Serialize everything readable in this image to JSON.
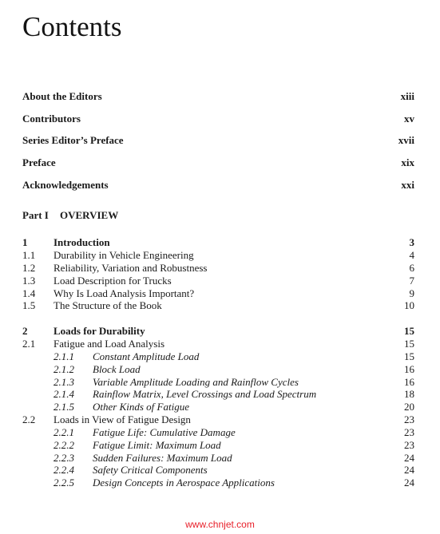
{
  "page": {
    "title": "Contents"
  },
  "front_matter": [
    {
      "label": "About the Editors",
      "page": "xiii"
    },
    {
      "label": "Contributors",
      "page": "xv"
    },
    {
      "label": "Series Editor’s Preface",
      "page": "xvii"
    },
    {
      "label": "Preface",
      "page": "xix"
    },
    {
      "label": "Acknowledgements",
      "page": "xxi"
    }
  ],
  "part": {
    "number": "Part I",
    "title": "OVERVIEW"
  },
  "chapters": [
    {
      "number": "1",
      "title": "Introduction",
      "page": "3",
      "sections": [
        {
          "number": "1.1",
          "title": "Durability in Vehicle Engineering",
          "page": "4"
        },
        {
          "number": "1.2",
          "title": "Reliability, Variation and Robustness",
          "page": "6"
        },
        {
          "number": "1.3",
          "title": "Load Description for Trucks",
          "page": "7"
        },
        {
          "number": "1.4",
          "title": "Why Is Load Analysis Important?",
          "page": "9"
        },
        {
          "number": "1.5",
          "title": "The Structure of the Book",
          "page": "10"
        }
      ]
    },
    {
      "number": "2",
      "title": "Loads for Durability",
      "page": "15",
      "sections": [
        {
          "number": "2.1",
          "title": "Fatigue and Load Analysis",
          "page": "15",
          "subsections": [
            {
              "number": "2.1.1",
              "title": "Constant Amplitude Load",
              "page": "15"
            },
            {
              "number": "2.1.2",
              "title": "Block Load",
              "page": "16"
            },
            {
              "number": "2.1.3",
              "title": "Variable Amplitude Loading and Rainflow Cycles",
              "page": "16"
            },
            {
              "number": "2.1.4",
              "title": "Rainflow Matrix, Level Crossings and Load Spectrum",
              "page": "18"
            },
            {
              "number": "2.1.5",
              "title": "Other Kinds of Fatigue",
              "page": "20"
            }
          ]
        },
        {
          "number": "2.2",
          "title": "Loads in View of Fatigue Design",
          "page": "23",
          "subsections": [
            {
              "number": "2.2.1",
              "title": "Fatigue Life: Cumulative Damage",
              "page": "23"
            },
            {
              "number": "2.2.2",
              "title": "Fatigue Limit: Maximum Load",
              "page": "23"
            },
            {
              "number": "2.2.3",
              "title": "Sudden Failures: Maximum Load",
              "page": "24"
            },
            {
              "number": "2.2.4",
              "title": "Safety Critical Components",
              "page": "24"
            },
            {
              "number": "2.2.5",
              "title": "Design Concepts in Aerospace Applications",
              "page": "24"
            }
          ]
        }
      ]
    }
  ],
  "watermark": {
    "text": "www.chnjet.com",
    "color": "#e8202a"
  }
}
